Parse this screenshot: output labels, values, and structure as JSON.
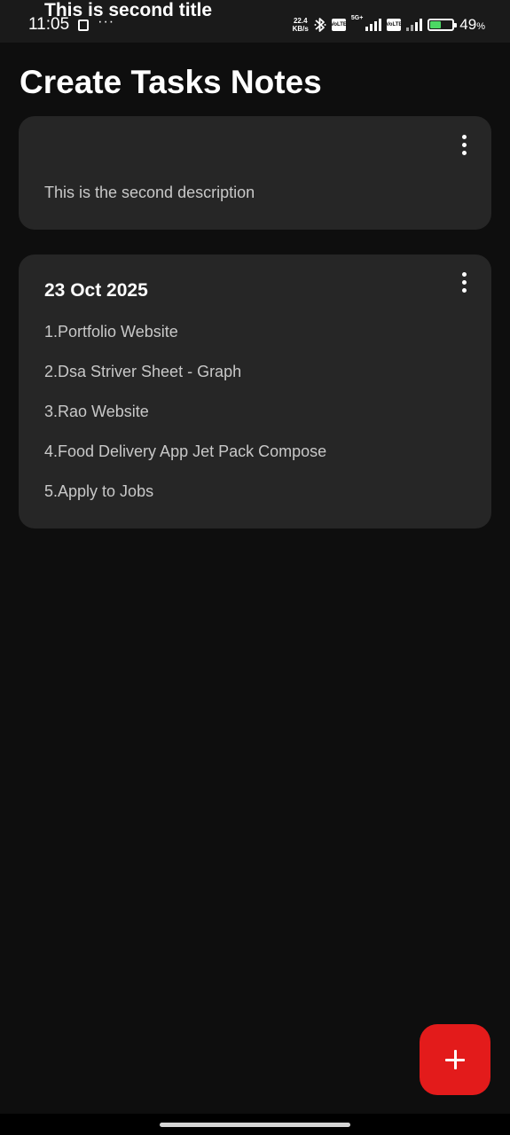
{
  "status_bar": {
    "time": "11:05",
    "overflow_dots": "···",
    "net_speed_value": "22.4",
    "net_speed_unit": "KB/s",
    "sim1_badge": "VoLTE",
    "net_type": "5G+",
    "sim2_badge": "VoLTE",
    "battery_percent": "49",
    "battery_percent_sign": "%",
    "battery_color": "#4cd964"
  },
  "page": {
    "title": "Create Tasks Notes"
  },
  "notes": [
    {
      "title": "This is second title",
      "lines": [
        "This is the second description"
      ]
    },
    {
      "title": "23 Oct 2025",
      "lines": [
        "1.Portfolio Website",
        "2.Dsa Striver Sheet - Graph",
        "3.Rao Website",
        "4.Food Delivery App Jet Pack Compose",
        "5.Apply to Jobs"
      ]
    }
  ],
  "fab": {
    "icon": "plus-icon",
    "color": "#e31b1b"
  },
  "theme": {
    "background": "#0e0e0e",
    "card_background": "#262626",
    "accent": "#e31b1b"
  }
}
